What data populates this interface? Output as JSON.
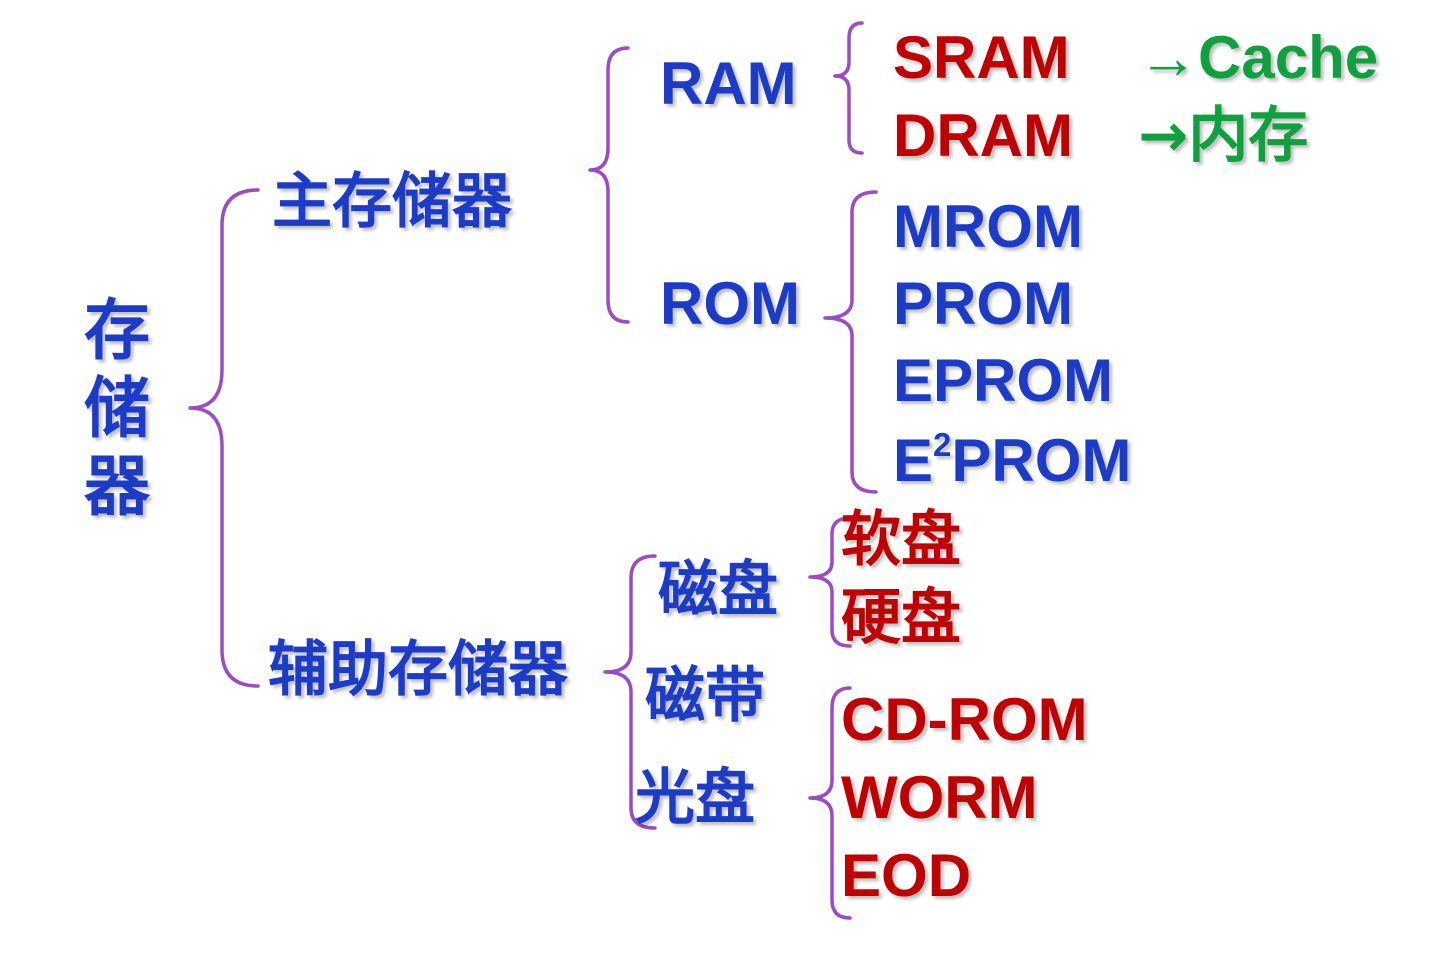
{
  "root": {
    "label": "存储器"
  },
  "main_memory": {
    "label": "主存储器",
    "ram": {
      "label": "RAM",
      "items": [
        {
          "label": "SRAM",
          "arrow": "→",
          "target": "Cache"
        },
        {
          "label": "DRAM",
          "arrow": "→",
          "target": "内存"
        }
      ]
    },
    "rom": {
      "label": "ROM",
      "items": [
        "MROM",
        "PROM",
        "EPROM"
      ],
      "e2prom": {
        "prefix": "E",
        "sup": "2",
        "suffix": "PROM"
      }
    }
  },
  "auxiliary_memory": {
    "label": "辅助存储器",
    "disk": {
      "label": "磁盘",
      "items": [
        "软盘",
        "硬盘"
      ]
    },
    "tape": {
      "label": "磁带"
    },
    "optical": {
      "label": "光盘",
      "items": [
        "CD-ROM",
        "WORM",
        "EOD"
      ]
    }
  },
  "colors": {
    "category": "#1c3cc8",
    "leaf": "#c00000",
    "mapping": "#10a040",
    "brace": "#9b4cc4"
  }
}
